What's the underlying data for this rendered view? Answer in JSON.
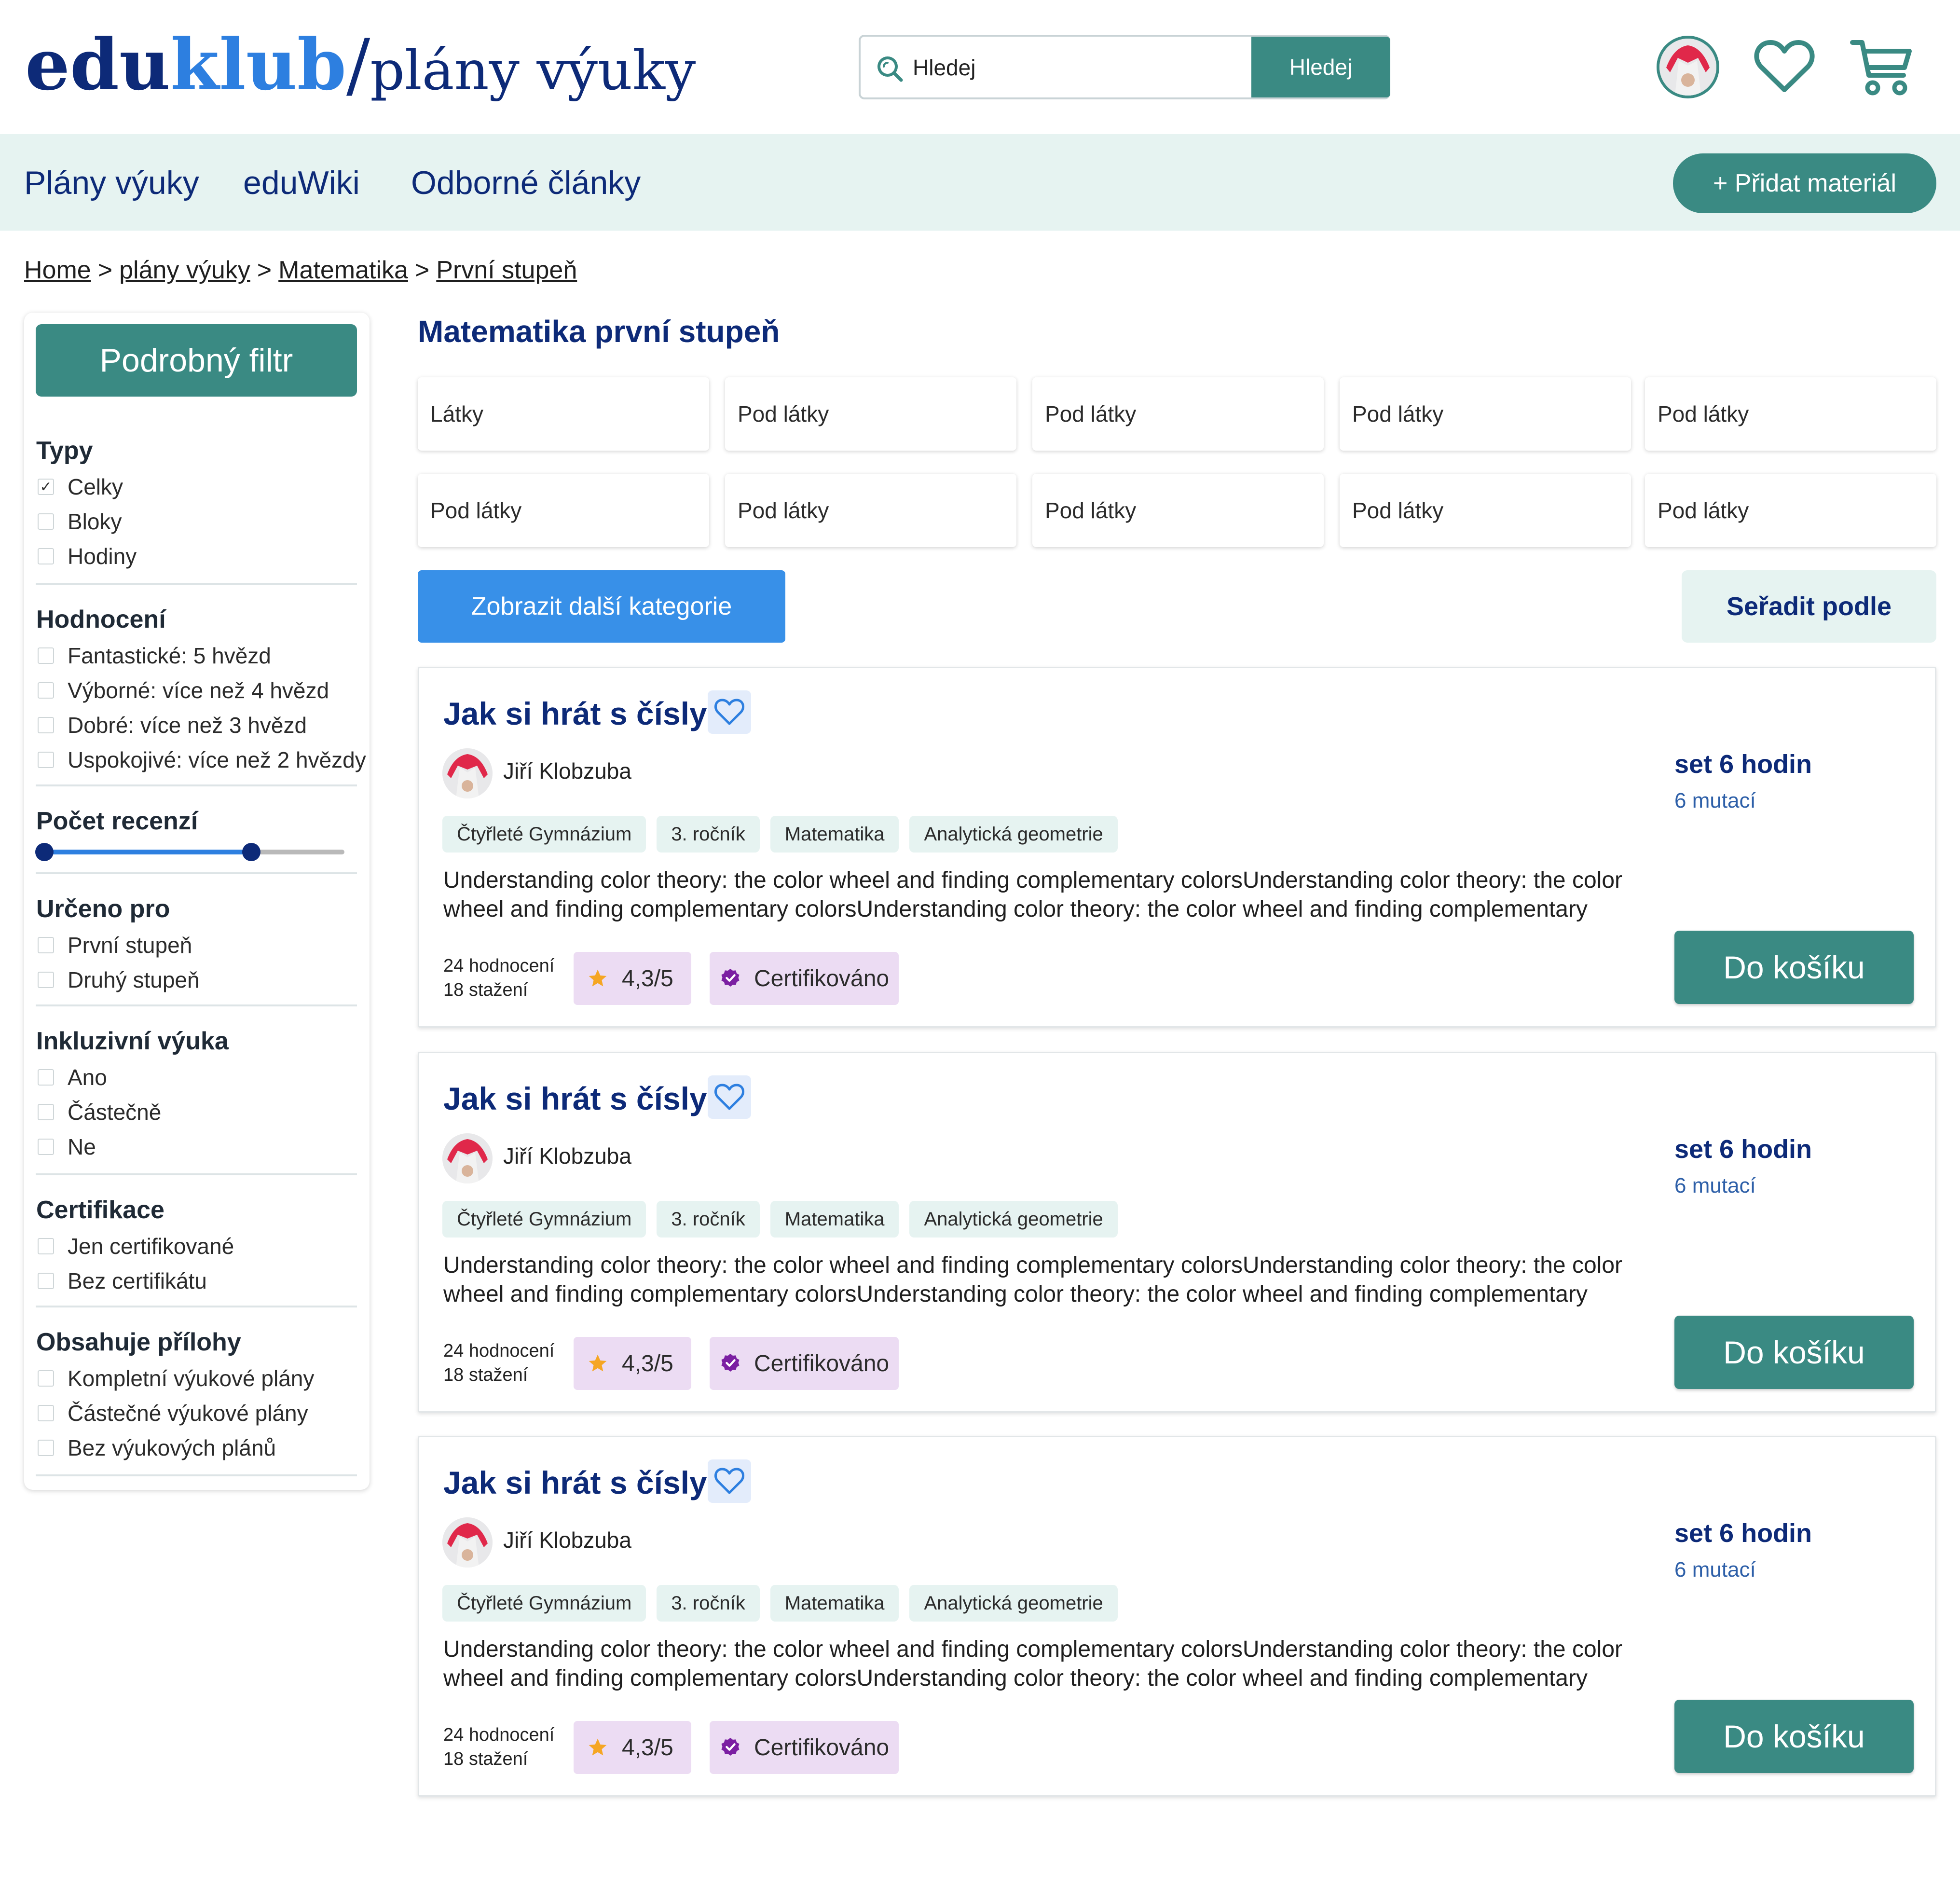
{
  "header": {
    "logo_part1": "edu",
    "logo_part2": "klub",
    "logo_part3": "/",
    "logo_part4": "plány výuky",
    "search_placeholder": "Hledej",
    "search_button": "Hledej"
  },
  "nav": {
    "items": [
      "Plány výuky",
      "eduWiki",
      "Odborné články"
    ],
    "add_button": "+ Přidat materiál"
  },
  "breadcrumb": [
    "Home",
    "plány výuky",
    "Matematika",
    "První stupeň"
  ],
  "sidebar": {
    "filter_button": "Podrobný filtr",
    "types": {
      "title": "Typy",
      "options": [
        "Celky",
        "Bloky",
        "Hodiny"
      ],
      "checked": [
        true,
        false,
        false
      ]
    },
    "rating": {
      "title": "Hodnocení",
      "options": [
        "Fantastické: 5 hvězd",
        "Výborné: více než 4 hvězd",
        "Dobré: více než 3 hvězd",
        "Uspokojivé: více než 2 hvězdy"
      ]
    },
    "reviews": {
      "title": "Počet recenzí",
      "range_fraction": [
        0.0,
        0.69
      ]
    },
    "audience": {
      "title": "Určeno pro",
      "options": [
        "První stupeň",
        "Druhý stupeň"
      ]
    },
    "inclusive": {
      "title": "Inkluzivní výuka",
      "options": [
        "Ano",
        "Částečně",
        "Ne"
      ]
    },
    "certification": {
      "title": "Certifikace",
      "options": [
        "Jen certifikované",
        "Bez certifikátu"
      ]
    },
    "attachments": {
      "title": "Obsahuje přílohy",
      "options": [
        "Kompletní výukové plány",
        "Částečné výukové plány",
        "Bez výukových plánů"
      ]
    }
  },
  "main": {
    "title": "Matematika první stupeň",
    "categories": [
      "Látky",
      "Pod látky",
      "Pod látky",
      "Pod látky",
      "Pod látky",
      "Pod látky",
      "Pod látky",
      "Pod látky",
      "Pod látky",
      "Pod látky"
    ],
    "more_categories": "Zobrazit další kategorie",
    "sort_button": "Seřadit podle"
  },
  "cards": [
    {
      "title": "Jak si hrát s čísly",
      "author": "Jiří Klobzuba",
      "tags": [
        "Čtyřleté Gymnázium",
        "3. ročník",
        "Matematika",
        "Analytická geometrie"
      ],
      "description": "Understanding color theory: the color wheel and finding complementary colorsUnderstanding color theory: the color wheel and finding complementary colorsUnderstanding color theory: the color wheel and finding complementary",
      "reviews": "24 hodnocení",
      "downloads": "18 stažení",
      "rating": "4,3/5",
      "certified": "Certifikováno",
      "set": "set 6 hodin",
      "mutations": "6 mutací",
      "cart_button": "Do košíku"
    },
    {
      "title": "Jak si hrát s čísly",
      "author": "Jiří Klobzuba",
      "tags": [
        "Čtyřleté Gymnázium",
        "3. ročník",
        "Matematika",
        "Analytická geometrie"
      ],
      "description": "Understanding color theory: the color wheel and finding complementary colorsUnderstanding color theory: the color wheel and finding complementary colorsUnderstanding color theory: the color wheel and finding complementary",
      "reviews": "24 hodnocení",
      "downloads": "18 stažení",
      "rating": "4,3/5",
      "certified": "Certifikováno",
      "set": "set 6 hodin",
      "mutations": "6 mutací",
      "cart_button": "Do košíku"
    },
    {
      "title": "Jak si hrát s čísly",
      "author": "Jiří Klobzuba",
      "tags": [
        "Čtyřleté Gymnázium",
        "3. ročník",
        "Matematika",
        "Analytická geometrie"
      ],
      "description": "Understanding color theory: the color wheel and finding complementary colorsUnderstanding color theory: the color wheel and finding complementary colorsUnderstanding color theory: the color wheel and finding complementary",
      "reviews": "24 hodnocení",
      "downloads": "18 stažení",
      "rating": "4,3/5",
      "certified": "Certifikováno",
      "set": "set 6 hodin",
      "mutations": "6 mutací",
      "cart_button": "Do košíku"
    }
  ],
  "colors": {
    "brand_navy": "#0d2a78",
    "brand_blue": "#2d7fe0",
    "teal": "#3a8a83",
    "nav_bg": "#e6f3f1",
    "badge_bg": "#ecdcf3",
    "cert_purple": "#7b1fa2",
    "star": "#f5a623"
  },
  "icons": {
    "search": "search-icon",
    "favorite": "heart-icon",
    "cart": "cart-icon",
    "star": "star-icon",
    "certified": "verified-badge-icon"
  }
}
